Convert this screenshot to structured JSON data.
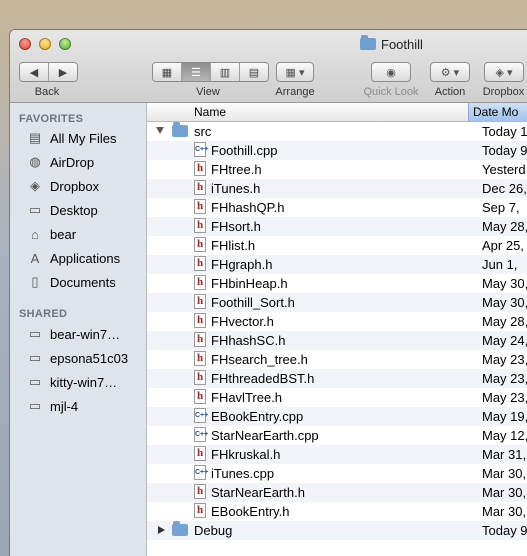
{
  "window": {
    "title": "Foothill"
  },
  "toolbar": {
    "back_label": "Back",
    "view_label": "View",
    "arrange_label": "Arrange",
    "quicklook_label": "Quick Look",
    "action_label": "Action",
    "dropbox_label": "Dropbox"
  },
  "sidebar": {
    "favorites_heading": "FAVORITES",
    "favorites": [
      {
        "label": "All My Files",
        "icon": "all-files-icon"
      },
      {
        "label": "AirDrop",
        "icon": "airdrop-icon"
      },
      {
        "label": "Dropbox",
        "icon": "dropbox-icon"
      },
      {
        "label": "Desktop",
        "icon": "desktop-icon"
      },
      {
        "label": "bear",
        "icon": "home-icon"
      },
      {
        "label": "Applications",
        "icon": "applications-icon"
      },
      {
        "label": "Documents",
        "icon": "documents-icon"
      }
    ],
    "shared_heading": "SHARED",
    "shared": [
      {
        "label": "bear-win7…",
        "icon": "computer-icon"
      },
      {
        "label": "epsona51c03",
        "icon": "computer-icon"
      },
      {
        "label": "kitty-win7…",
        "icon": "computer-icon"
      },
      {
        "label": "mjl-4",
        "icon": "computer-icon"
      }
    ]
  },
  "list": {
    "col_name": "Name",
    "col_date": "Date Mo",
    "rows": [
      {
        "name": "src",
        "type": "folder-open",
        "date": "Today 1"
      },
      {
        "name": "Foothill.cpp",
        "type": "cpp",
        "date": "Today 9"
      },
      {
        "name": "FHtree.h",
        "type": "h",
        "date": "Yesterd"
      },
      {
        "name": "iTunes.h",
        "type": "h",
        "date": "Dec 26,"
      },
      {
        "name": "FHhashQP.h",
        "type": "h",
        "date": "Sep 7,"
      },
      {
        "name": "FHsort.h",
        "type": "h",
        "date": "May 28,"
      },
      {
        "name": "FHlist.h",
        "type": "h",
        "date": "Apr 25,"
      },
      {
        "name": "FHgraph.h",
        "type": "h",
        "date": "Jun 1,"
      },
      {
        "name": "FHbinHeap.h",
        "type": "h",
        "date": "May 30,"
      },
      {
        "name": "Foothill_Sort.h",
        "type": "h",
        "date": "May 30,"
      },
      {
        "name": "FHvector.h",
        "type": "h",
        "date": "May 28,"
      },
      {
        "name": "FHhashSC.h",
        "type": "h",
        "date": "May 24,"
      },
      {
        "name": "FHsearch_tree.h",
        "type": "h",
        "date": "May 23,"
      },
      {
        "name": "FHthreadedBST.h",
        "type": "h",
        "date": "May 23,"
      },
      {
        "name": "FHavlTree.h",
        "type": "h",
        "date": "May 23,"
      },
      {
        "name": "EBookEntry.cpp",
        "type": "cpp",
        "date": "May 19,"
      },
      {
        "name": "StarNearEarth.cpp",
        "type": "cpp",
        "date": "May 12,"
      },
      {
        "name": "FHkruskal.h",
        "type": "h",
        "date": "Mar 31,"
      },
      {
        "name": "iTunes.cpp",
        "type": "cpp",
        "date": "Mar 30,"
      },
      {
        "name": "StarNearEarth.h",
        "type": "h",
        "date": "Mar 30,"
      },
      {
        "name": "EBookEntry.h",
        "type": "h",
        "date": "Mar 30,"
      },
      {
        "name": "Debug",
        "type": "folder-closed",
        "date": "Today 9"
      }
    ]
  }
}
